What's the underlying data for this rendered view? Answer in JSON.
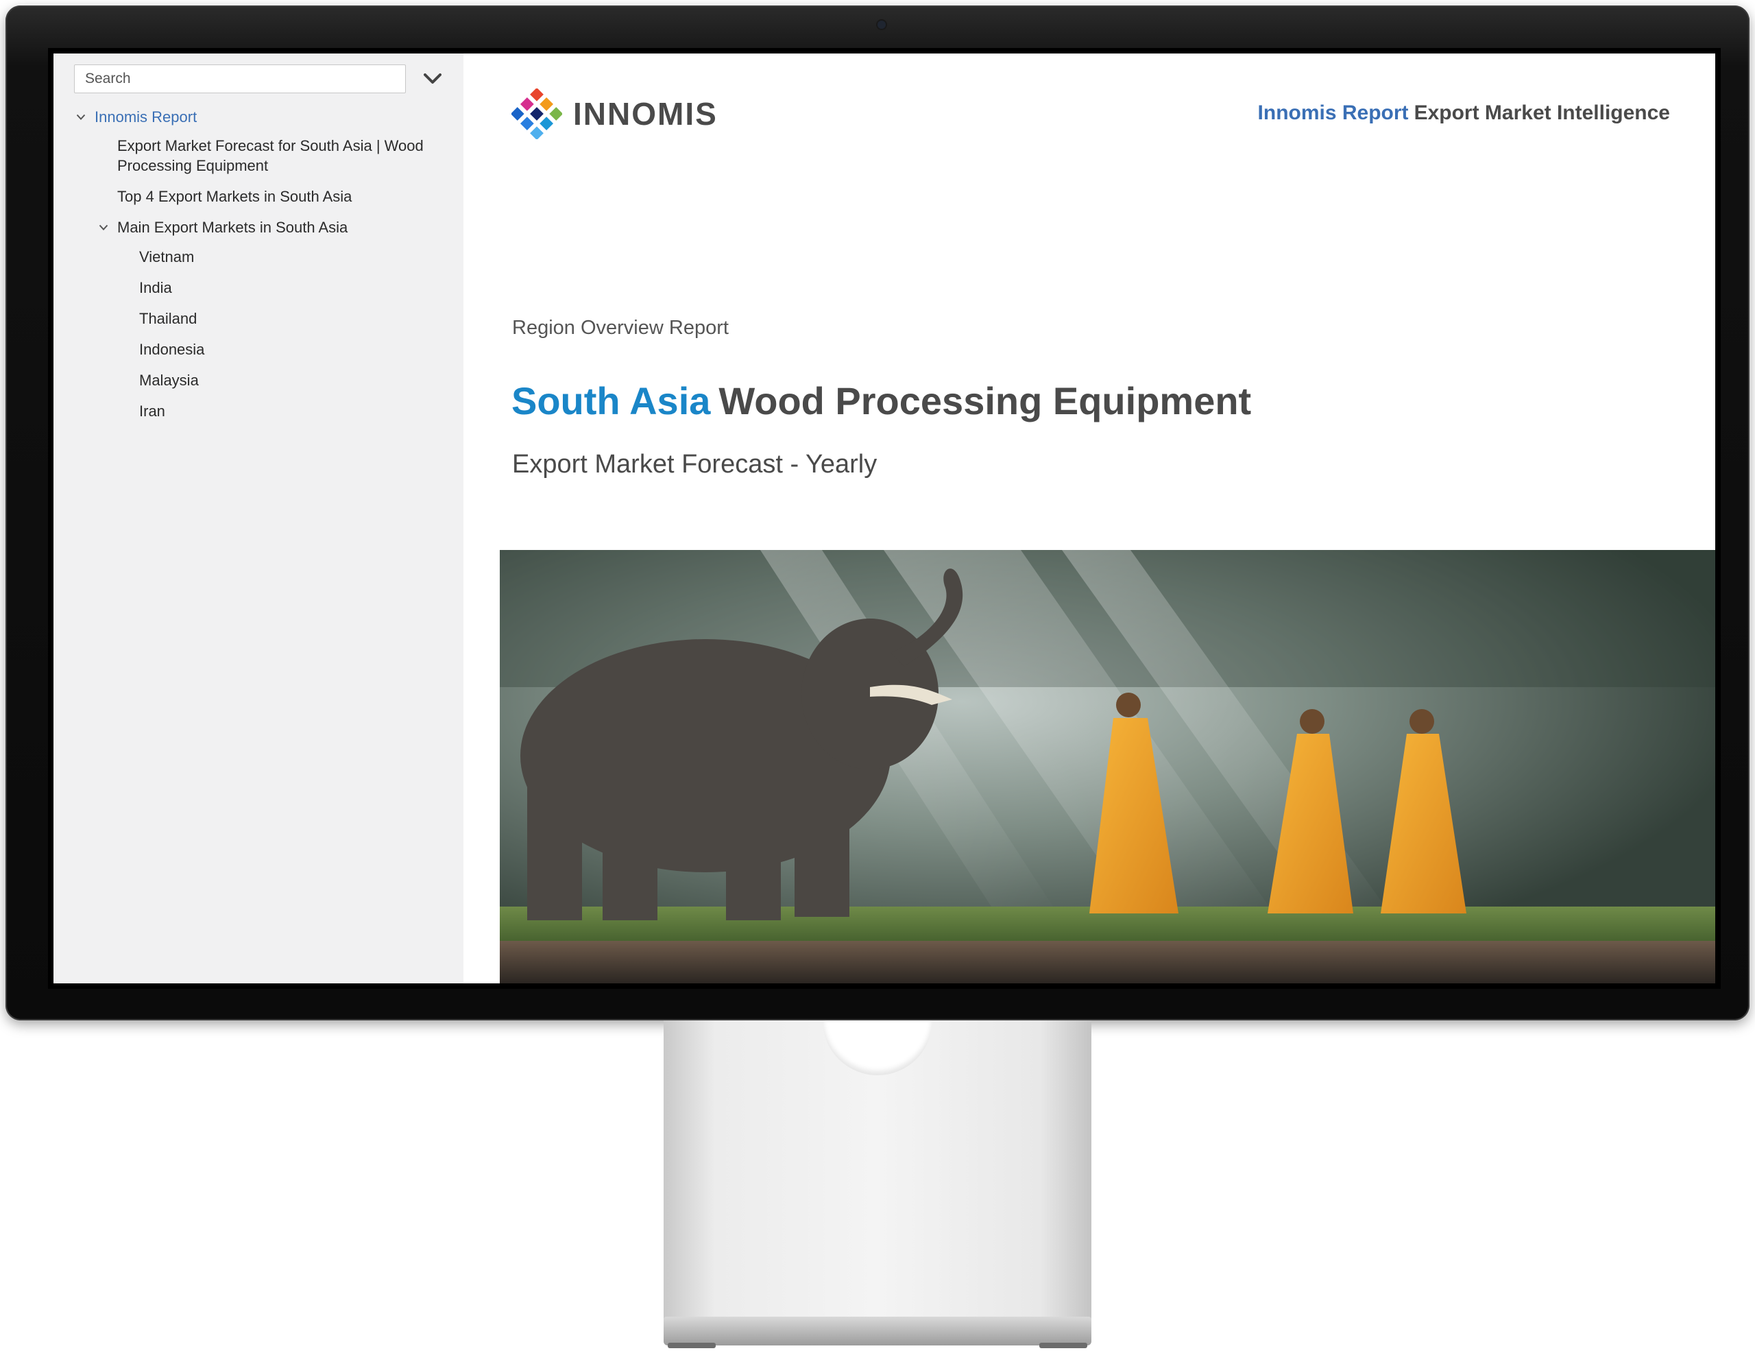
{
  "sidebar": {
    "search_placeholder": "Search",
    "toggle_icon": "chevron-down-icon",
    "items": [
      {
        "label": "Innomis Report",
        "expanded": true
      },
      {
        "label": "Export Market Forecast for South Asia | Wood Processing Equipment"
      },
      {
        "label": "Top 4 Export Markets in South Asia"
      },
      {
        "label": "Main Export Markets in South Asia",
        "expanded": true
      },
      {
        "label": "Vietnam"
      },
      {
        "label": "India"
      },
      {
        "label": "Thailand"
      },
      {
        "label": "Indonesia"
      },
      {
        "label": "Malaysia"
      },
      {
        "label": "Iran"
      }
    ]
  },
  "header": {
    "logo_text": "INNOMIS",
    "brand": "Innomis Report",
    "tagline": "Export Market Intelligence"
  },
  "report": {
    "eyebrow": "Region Overview Report",
    "title_region": "South Asia",
    "title_product": "Wood Processing Equipment",
    "subtitle": "Export Market Forecast - Yearly"
  },
  "colors": {
    "brand_blue": "#3a6fb5",
    "title_accent": "#1a86c8",
    "text_dark": "#4a4a4a",
    "sidebar_bg": "#f1f1f2"
  }
}
